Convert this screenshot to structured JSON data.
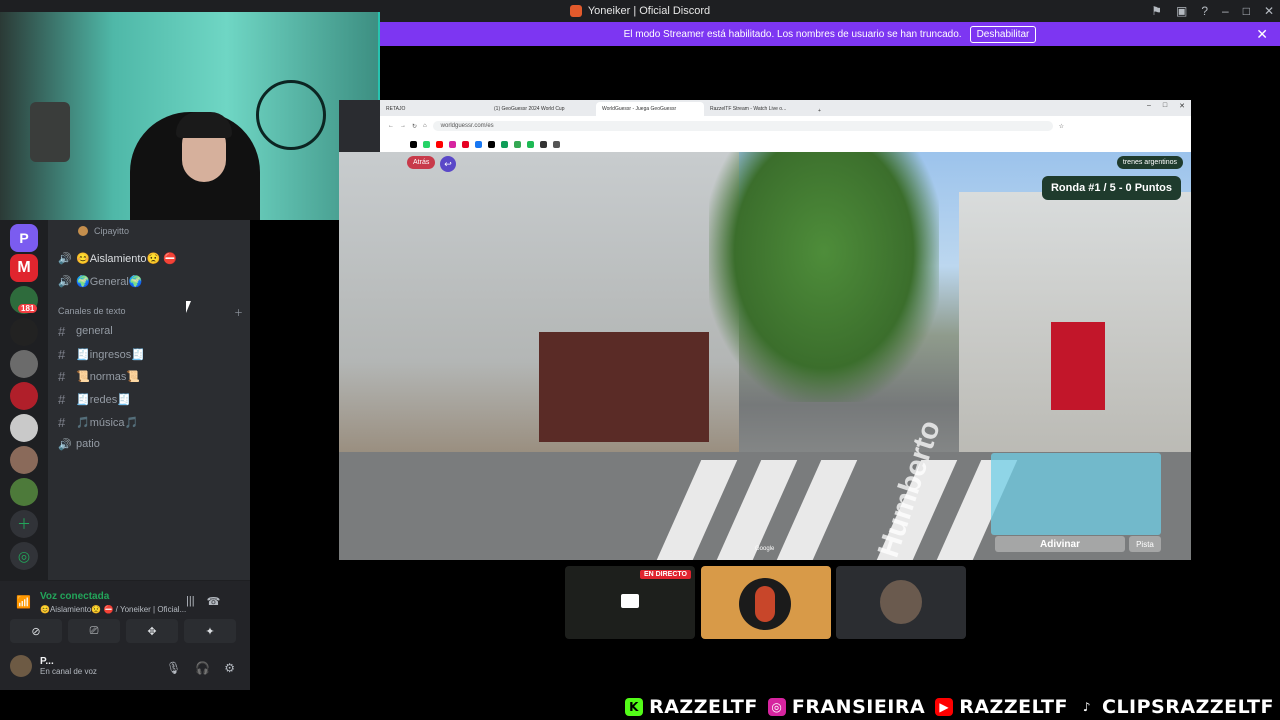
{
  "titlebar": {
    "title": "Yoneiker | Oficial Discord"
  },
  "banner": {
    "message": "El modo Streamer está habilitado. Los nombres de usuario se han truncado.",
    "button_label": "Deshabilitar",
    "close_icon": "close-icon"
  },
  "servers": [
    {
      "name": "server-p",
      "letter": "P"
    },
    {
      "name": "server-m",
      "letter": "M"
    },
    {
      "name": "server-badge",
      "badge": "181"
    }
  ],
  "channels": {
    "voice_member": "Cipayitto",
    "voice": [
      {
        "label": "😊Aislamiento😟 ⛔"
      },
      {
        "label": "🌍General🌍"
      }
    ],
    "category_text": "Canales de texto",
    "text": [
      {
        "label": "general"
      },
      {
        "label": "🧾ingresos🧾"
      },
      {
        "label": "📜normas📜"
      },
      {
        "label": "🧾redes🧾"
      },
      {
        "label": "🎵música🎵"
      }
    ],
    "voice_extra": {
      "label": "patio"
    }
  },
  "voice_panel": {
    "status": "Voz conectada",
    "location": "😊Aislamiento😟 ⛔ / Yoneiker | Oficial..."
  },
  "user": {
    "name": "P...",
    "status": "En canal de voz"
  },
  "browser": {
    "tabs": [
      {
        "label": "RETAJO"
      },
      {
        "label": "(1) GeoGuessr 2024 World Cup"
      },
      {
        "label": "WorldGuessr - Juega GeoGuessr"
      },
      {
        "label": "RazzelTF Stream - Watch Live o..."
      }
    ],
    "url": "worldguessr.com/es"
  },
  "game": {
    "round": "Ronda #1 / 5 - 0 Puntos",
    "chip": "trenes argentinos",
    "back_label": "Atrás",
    "guess_label": "Adivinar",
    "hint_label": "Pista",
    "street_text": "Humberto",
    "logo_small": "Google"
  },
  "tiles": [
    {
      "name": "tile-screen",
      "badge": "EN DIRECTO"
    },
    {
      "name": "tile-hotdog"
    },
    {
      "name": "tile-avatar"
    }
  ],
  "footer": [
    {
      "platform": "kick",
      "handle": "RAZZELTF",
      "color": "#53fc18"
    },
    {
      "platform": "instagram",
      "handle": "FRANSIEIRA",
      "color": "#d6249f"
    },
    {
      "platform": "youtube",
      "handle": "RAZZELTF",
      "color": "#ff0000"
    },
    {
      "platform": "tiktok",
      "handle": "CLIPSRAZZELTF",
      "color": "#ffffff"
    }
  ]
}
